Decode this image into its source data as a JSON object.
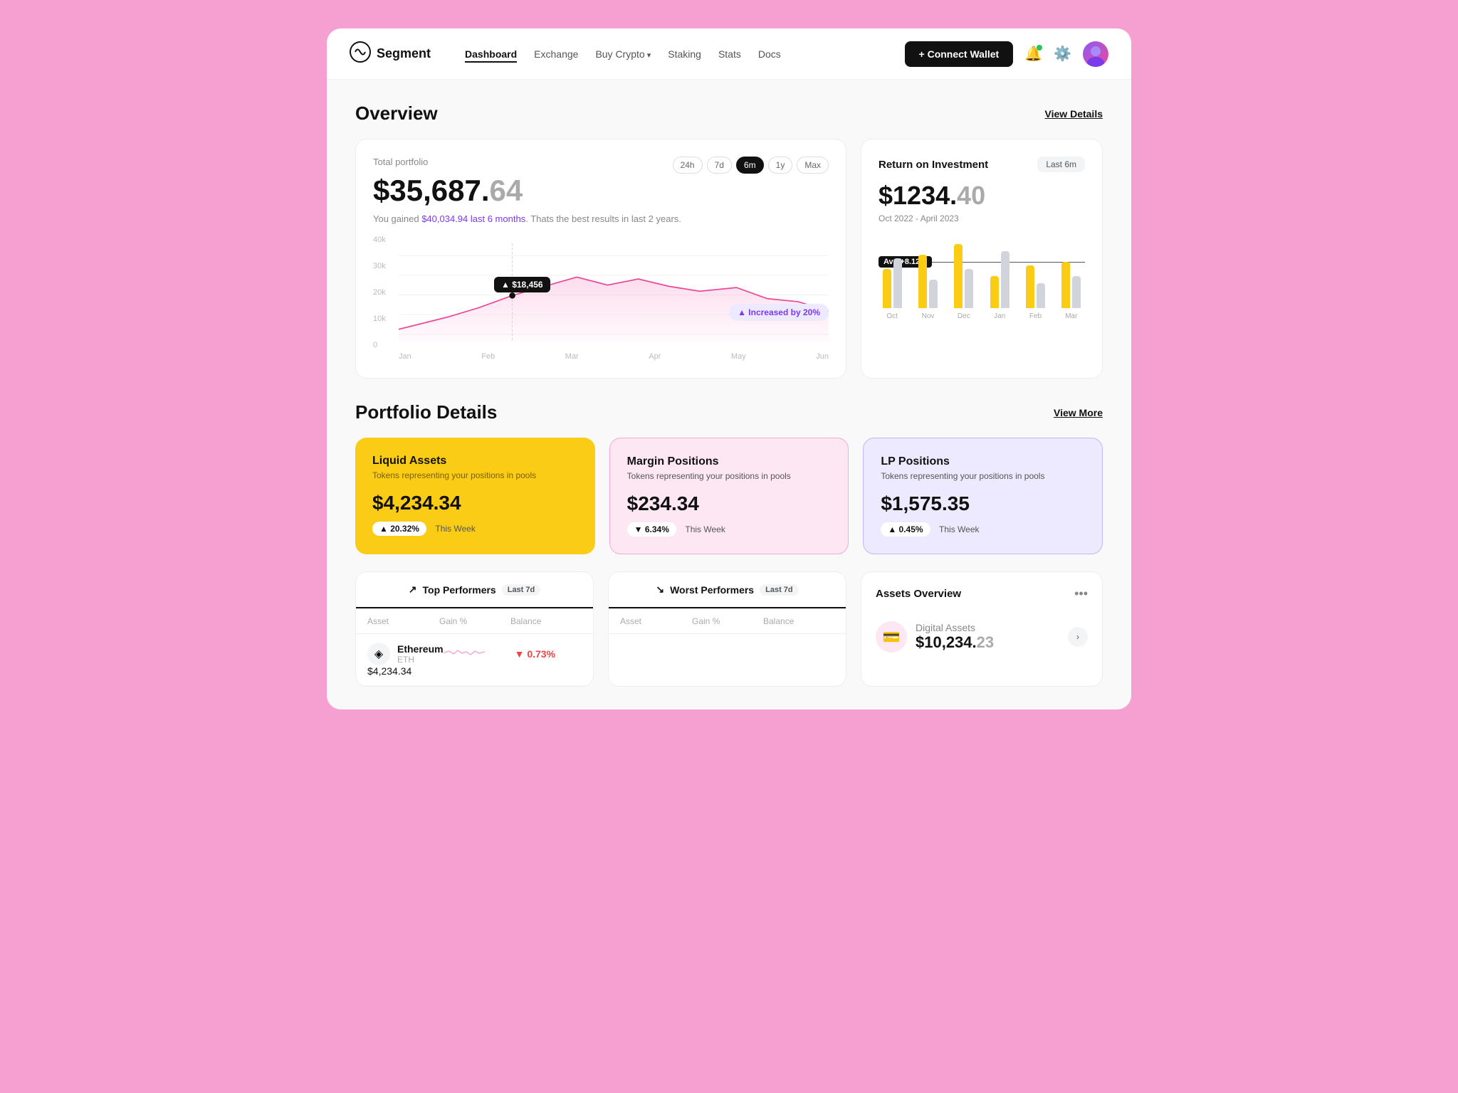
{
  "app": {
    "logo_text": "Segment",
    "logo_icon": "◎"
  },
  "nav": {
    "links": [
      {
        "label": "Dashboard",
        "active": true
      },
      {
        "label": "Exchange",
        "active": false
      },
      {
        "label": "Buy Crypto",
        "active": false,
        "arrow": true
      },
      {
        "label": "Staking",
        "active": false
      },
      {
        "label": "Stats",
        "active": false
      },
      {
        "label": "Docs",
        "active": false
      }
    ],
    "connect_wallet": "+ Connect Wallet"
  },
  "overview": {
    "title": "Overview",
    "view_link": "View Details",
    "portfolio": {
      "label": "Total portfolio",
      "value": "$35,687.",
      "cents": "64",
      "desc_prefix": "You gained ",
      "desc_highlight": "$40,034.94 last 6 months",
      "desc_suffix": ". Thats the best results in last 2 years.",
      "time_filters": [
        "24h",
        "7d",
        "6m",
        "1y",
        "Max"
      ],
      "active_filter": "6m",
      "tooltip": "▲ $18,456",
      "badge": "▲ Increased by 20%",
      "x_labels": [
        "Jan",
        "Feb",
        "Mar",
        "Apr",
        "May",
        "Jun"
      ],
      "y_labels": [
        "40k",
        "30k",
        "20k",
        "10k",
        "0"
      ]
    },
    "roi": {
      "title": "Return on Investment",
      "period_btn": "Last 6m",
      "value": "$1234.",
      "cents": "40",
      "dates": "Oct 2022 - April 2023",
      "avg_badge": "Avg +8.12%",
      "x_labels": [
        "Oct",
        "Nov",
        "Dec",
        "Jan",
        "Feb",
        "Mar"
      ],
      "bars": [
        {
          "yellow": 55,
          "gray": 70
        },
        {
          "yellow": 75,
          "gray": 40
        },
        {
          "yellow": 90,
          "gray": 55
        },
        {
          "yellow": 45,
          "gray": 80
        },
        {
          "yellow": 60,
          "gray": 35
        },
        {
          "yellow": 65,
          "gray": 45
        }
      ]
    }
  },
  "portfolio_details": {
    "title": "Portfolio Details",
    "view_link": "View More",
    "cards": [
      {
        "type": "yellow",
        "title": "Liquid Assets",
        "subtitle": "Tokens representing your positions in pools",
        "value": "$4,234.34",
        "change": "▲ 20.32%",
        "change_type": "up",
        "period": "This Week"
      },
      {
        "type": "pink",
        "title": "Margin Positions",
        "subtitle": "Tokens representing your positions in pools",
        "value": "$234.34",
        "change": "▼ 6.34%",
        "change_type": "down",
        "period": "This Week"
      },
      {
        "type": "purple",
        "title": "LP Positions",
        "subtitle": "Tokens representing your positions in pools",
        "value": "$1,575.35",
        "change": "▲ 0.45%",
        "change_type": "up",
        "period": "This Week"
      }
    ]
  },
  "top_performers": {
    "tab_label": "Top Performers",
    "tab_period": "Last 7d",
    "worst_tab_label": "Worst Performers",
    "worst_tab_period": "Last 7d",
    "columns": [
      "Asset",
      "Gain %",
      "Balance"
    ],
    "rows": [
      {
        "icon": "◈",
        "name": "Ethereum",
        "symbol": "ETH",
        "gain": "0.73%",
        "gain_type": "down",
        "balance": "$4,234.34"
      }
    ]
  },
  "assets_overview": {
    "title": "Assets Overview",
    "more_icon": "•••",
    "items": [
      {
        "icon": "💳",
        "name": "Digital Assets",
        "value": "$10,234.",
        "cents": "23"
      }
    ]
  }
}
